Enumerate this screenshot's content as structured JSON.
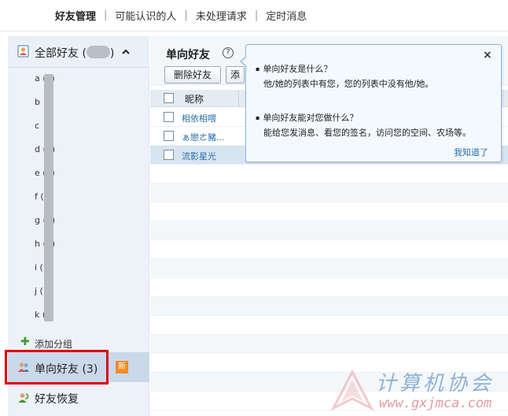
{
  "nav": {
    "tabs": [
      "好友管理",
      "可能认识的人",
      "未处理请求",
      "定时消息"
    ],
    "separator": "|"
  },
  "sidebar": {
    "header_label": "全部好友",
    "header_count_open": "(",
    "header_count_close": ")",
    "groups": [
      "a (3)",
      "b",
      "c",
      "d (7)",
      "e (5)",
      "f (",
      "g (4)",
      "h (1)",
      "i (",
      "j (",
      "k ("
    ],
    "add_group": "添加分组",
    "oneway_label": "单向好友 (3)",
    "new_badge": "新",
    "restore_label": "好友恢复"
  },
  "main": {
    "title": "单向好友",
    "help": "?",
    "delete_button": "删除好友",
    "add_button": "添",
    "column_nickname": "昵称",
    "rows": [
      {
        "name": "相依相喂",
        "selected": false
      },
      {
        "name": "ぁ戀ㄜ豬...",
        "selected": false
      },
      {
        "name": "流影星光",
        "selected": true
      }
    ]
  },
  "popup": {
    "close": "×",
    "q1": "单向好友是什么？",
    "a1": "他/她的列表中有您，您的列表中没有他/她。",
    "q2": "单向好友能对您做什么？",
    "a2": "能给您发消息、看您的签名，访问您的空间、农场等。",
    "ok": "我知道了"
  },
  "watermark": {
    "title": "计算机协会",
    "url": "www.gxjmca.com"
  },
  "colors": {
    "sidebar_bg": "#ecf2f8",
    "selected_row": "#d7e5f3",
    "link": "#2a6ca8",
    "highlight_frame": "#e00000",
    "new_badge": "#f08a24"
  }
}
